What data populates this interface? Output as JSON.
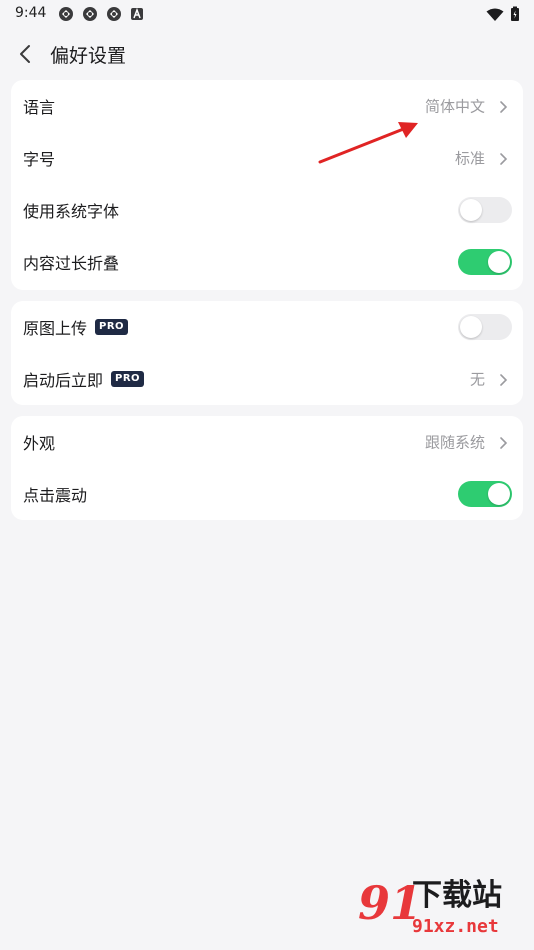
{
  "status_bar": {
    "time": "9:44",
    "notification_icons": [
      "sync-icon",
      "sync-icon",
      "sync-icon",
      "a-letter-icon"
    ],
    "right_icons": [
      "wifi-icon",
      "battery-icon"
    ]
  },
  "header": {
    "title": "偏好设置",
    "back_icon": "chevron-left-icon"
  },
  "groups": [
    {
      "rows": [
        {
          "label": "语言",
          "value": "简体中文",
          "control": "link"
        },
        {
          "label": "字号",
          "value": "标准",
          "control": "link"
        },
        {
          "label": "使用系统字体",
          "control": "toggle",
          "on": false
        },
        {
          "label": "内容过长折叠",
          "control": "toggle",
          "on": true
        }
      ]
    },
    {
      "rows": [
        {
          "label": "原图上传",
          "badge": "PRO",
          "control": "toggle",
          "on": false
        },
        {
          "label": "启动后立即",
          "badge": "PRO",
          "value": "无",
          "control": "link"
        }
      ]
    },
    {
      "rows": [
        {
          "label": "外观",
          "value": "跟随系统",
          "control": "link"
        },
        {
          "label": "点击震动",
          "control": "toggle",
          "on": true
        }
      ]
    }
  ],
  "watermark": {
    "number": "91",
    "text": "下载站",
    "url": "91xz.net"
  },
  "colors": {
    "background": "#f5f5f7",
    "card": "#ffffff",
    "toggle_on": "#2ecc71",
    "toggle_off": "#ececee",
    "secondary_text": "#9b9b9f",
    "pro_badge": "#1f2a44",
    "annotation_arrow": "#e02424",
    "watermark_red": "#e8383b"
  }
}
